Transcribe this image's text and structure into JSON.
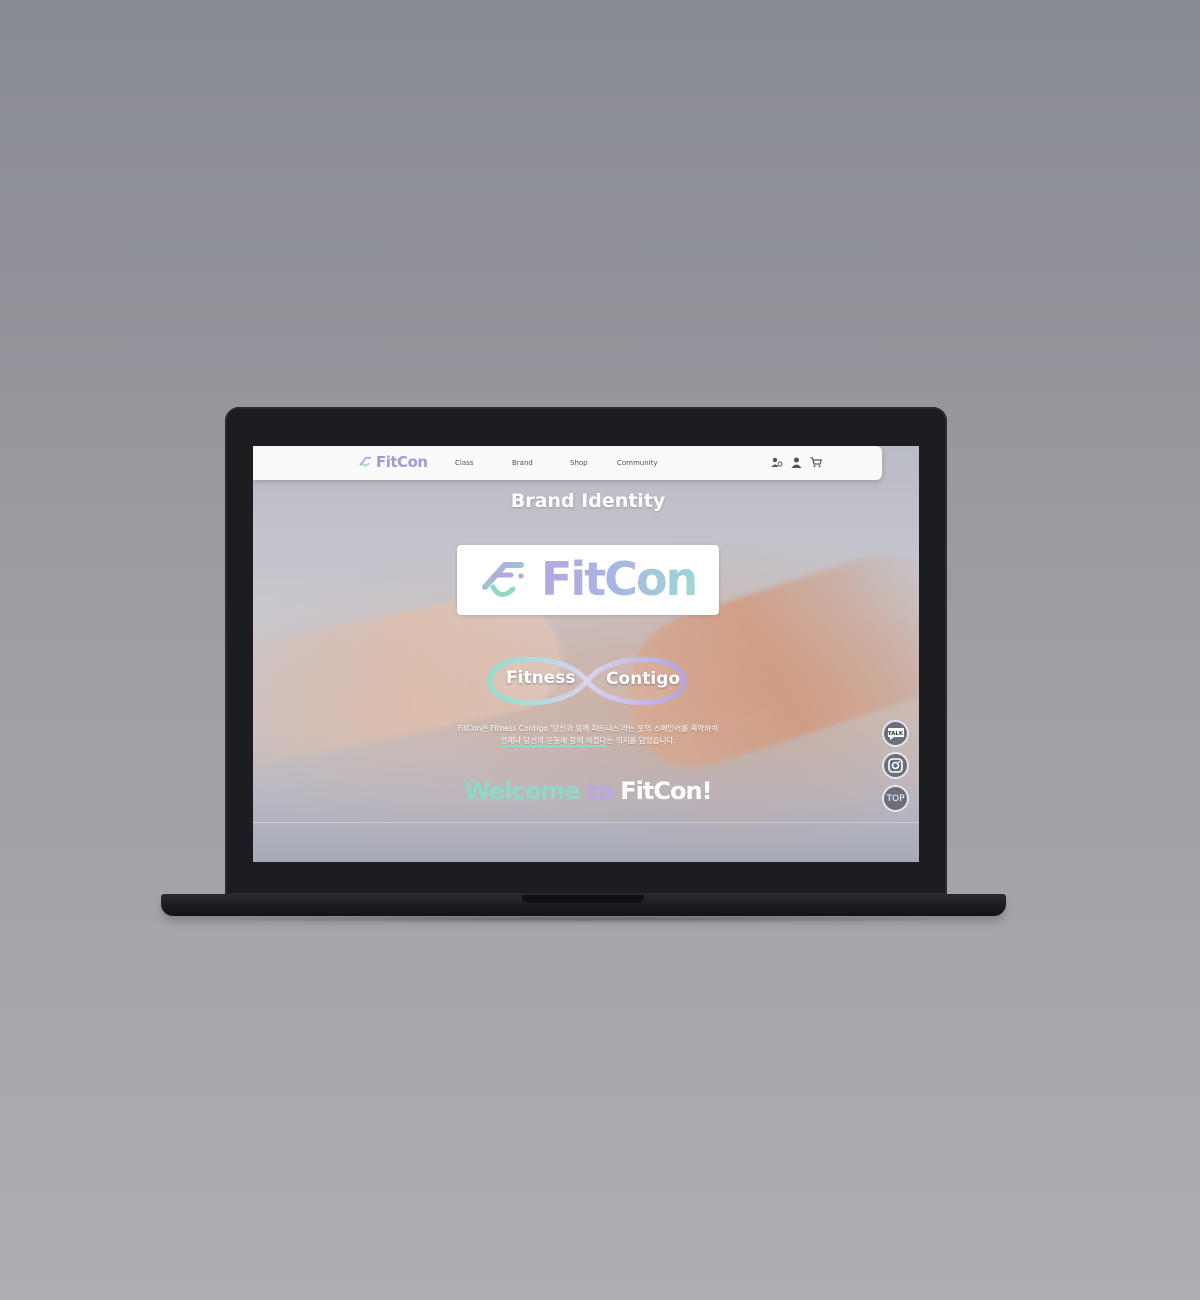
{
  "nav": {
    "logo_text": "FitCon",
    "links": [
      "Class",
      "Brand",
      "Shop",
      "Community"
    ],
    "icons": [
      "user-group-icon",
      "user-icon",
      "cart-icon"
    ]
  },
  "hero": {
    "title": "Brand Identity",
    "logo_text": "FitCon",
    "infinity_left": "Fitness",
    "infinity_right": "Contigo",
    "description_line1": "FitCon은 Fitness Contigo '당신과 함께 피트니스'라는 뜻의 스페인어를 축약하여",
    "description_line2_highlight": "언제나 당신의 운동에 함께 하겠다",
    "description_line2_rest": "는 의지를 담았습니다.",
    "welcome_part1": "Welcome",
    "welcome_part2": "to",
    "welcome_part3": "FitCon!"
  },
  "floating_buttons": {
    "talk": "TALK",
    "instagram_icon": "instagram-icon",
    "top": "TOP"
  },
  "colors": {
    "mint": "#8fd9c6",
    "lavender": "#b7a8e4",
    "float_bg": "#6b6e7c"
  }
}
